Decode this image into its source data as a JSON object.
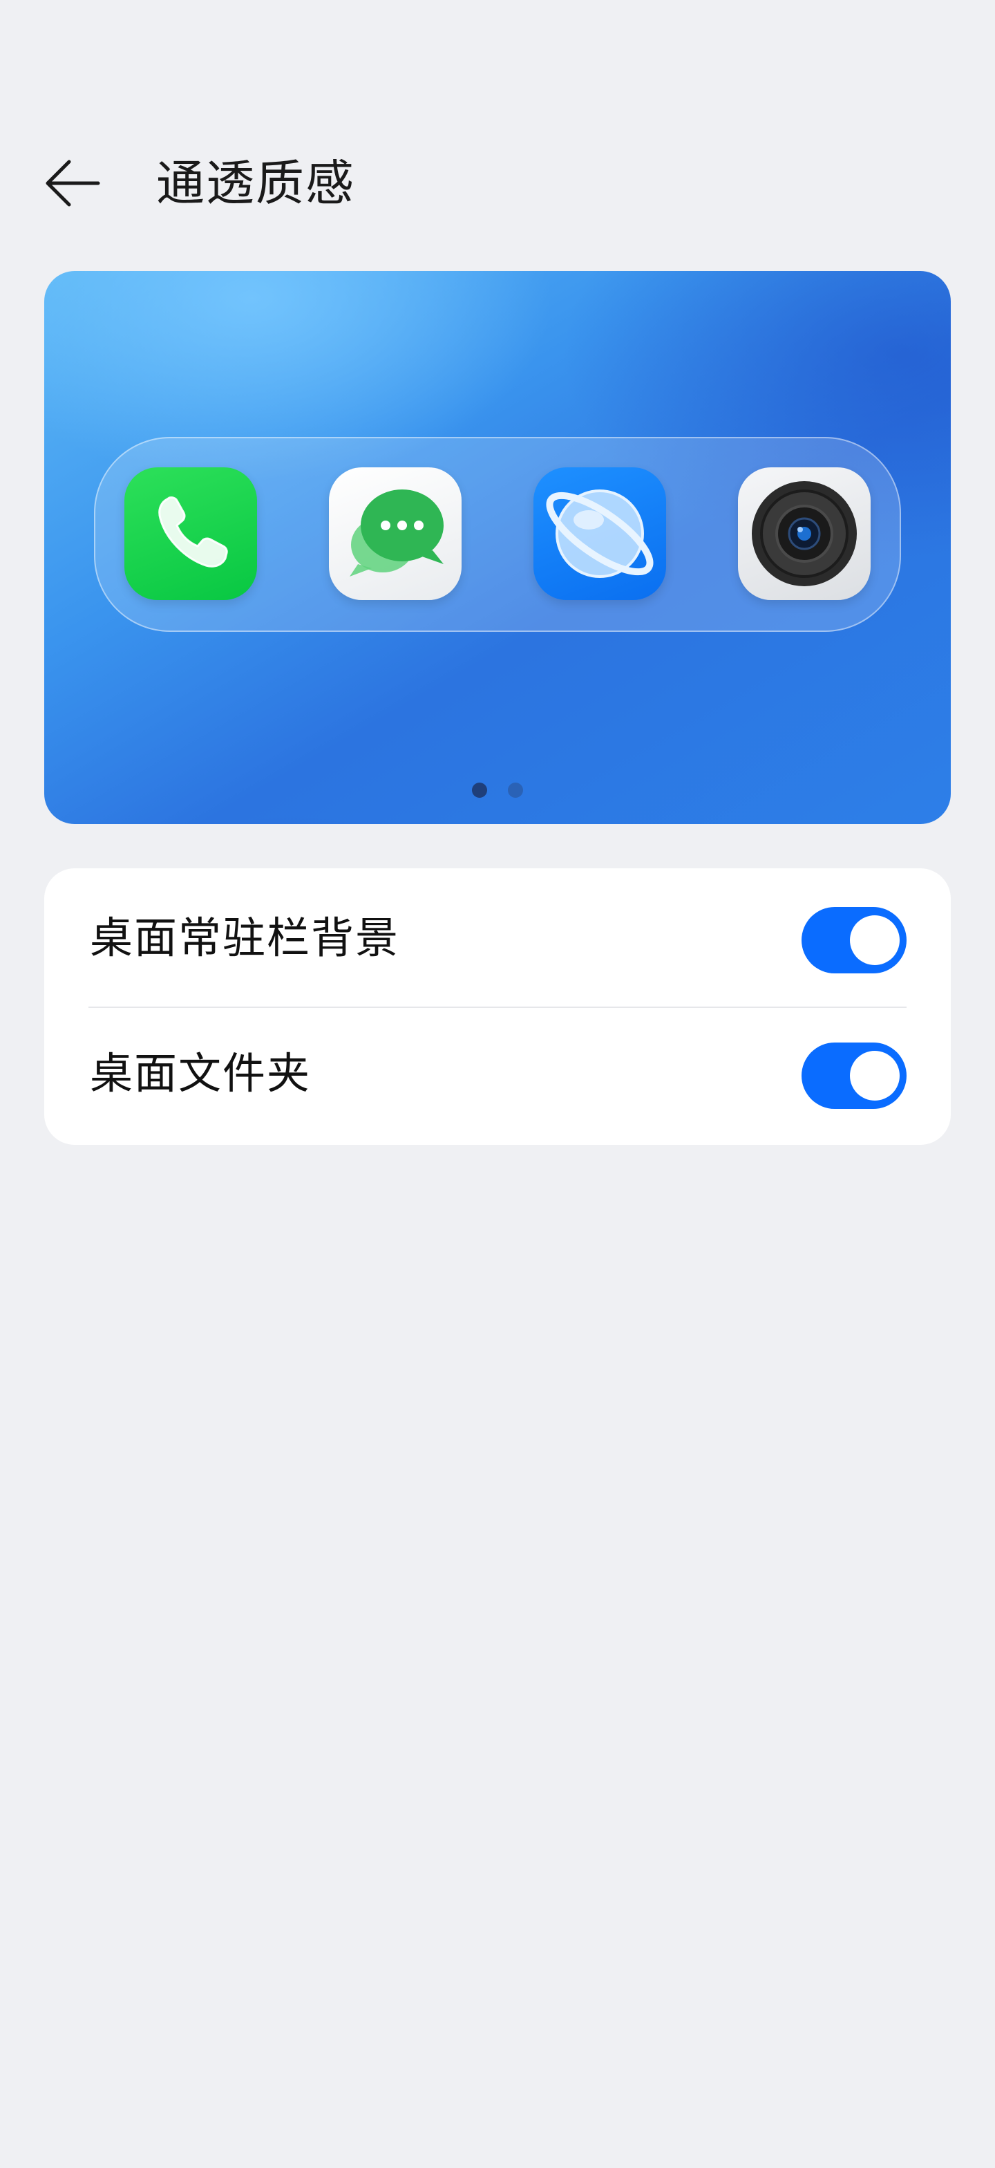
{
  "header": {
    "title": "通透质感",
    "back_icon": "arrow-left-icon"
  },
  "preview": {
    "dock_apps": [
      {
        "name": "phone",
        "icon": "phone-icon",
        "color": "#08c742"
      },
      {
        "name": "messages",
        "icon": "message-bubble-icon",
        "color": "#2db84e"
      },
      {
        "name": "browser",
        "icon": "globe-icon",
        "color": "#0a6ff0"
      },
      {
        "name": "camera",
        "icon": "camera-lens-icon",
        "color": "#2b2b2b"
      }
    ],
    "page_indicator": {
      "count": 2,
      "active": 1
    }
  },
  "settings": [
    {
      "label": "桌面常驻栏背景",
      "enabled": true
    },
    {
      "label": "桌面文件夹",
      "enabled": true
    }
  ],
  "colors": {
    "background": "#eff0f3",
    "accent": "#0a6cff",
    "card": "#ffffff"
  }
}
